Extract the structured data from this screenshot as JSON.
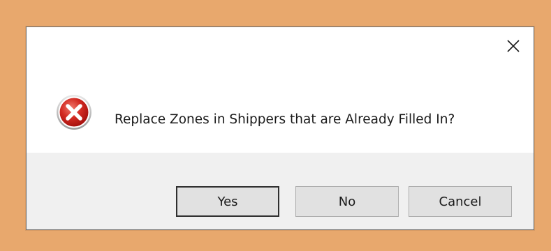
{
  "dialog": {
    "message": "Replace Zones in Shippers that are Already Filled In?",
    "icon": "error-icon",
    "close_icon": "close-icon",
    "buttons": {
      "yes": "Yes",
      "no": "No",
      "cancel": "Cancel"
    },
    "default_button": "yes"
  },
  "colors": {
    "desktop_background": "#e8a86d",
    "dialog_background": "#ffffff",
    "footer_background": "#f0f0f0",
    "error_red": "#c8201e"
  }
}
